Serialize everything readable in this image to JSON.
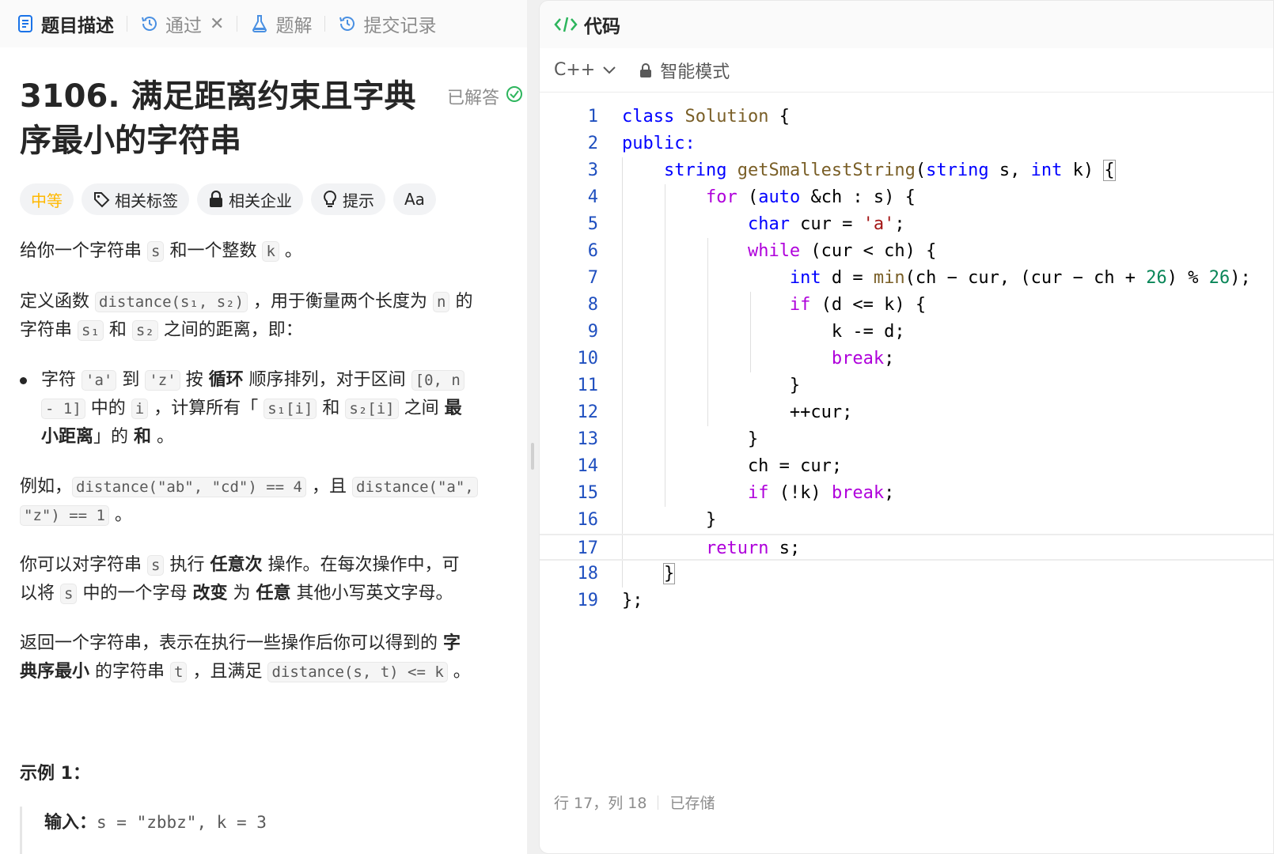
{
  "tabs": [
    {
      "label": "题目描述",
      "icon": "document-icon",
      "active": true
    },
    {
      "label": "通过",
      "icon": "history-icon",
      "closable": true
    },
    {
      "label": "题解",
      "icon": "flask-icon"
    },
    {
      "label": "提交记录",
      "icon": "history-icon"
    }
  ],
  "problem": {
    "title_line1": "3106. 满足距离约束且字典",
    "title_line2": "序最小的字符串",
    "status": "已解答"
  },
  "tags": {
    "difficulty": "中等",
    "related_tags": "相关标签",
    "related_companies": "相关企业",
    "hint": "提示",
    "font_toggle": "Aa"
  },
  "desc": {
    "p1": {
      "a": "给你一个字符串 ",
      "code_s": "s",
      "b": " 和一个整数 ",
      "code_k": "k",
      "c": " 。"
    },
    "p2": {
      "a": "定义函数 ",
      "code_dist": "distance(s₁, s₂)",
      "b": " ，用于衡量两个长度为 ",
      "code_n": "n",
      "c": " 的",
      "d": "字符串 ",
      "code_s1": "s₁",
      "e": " 和 ",
      "code_s2": "s₂",
      "f": " 之间的距离，即："
    },
    "bullet": {
      "a": "字符 ",
      "code_a": "'a'",
      "b": " 到 ",
      "code_z": "'z'",
      "c": " 按 ",
      "bold1": "循环",
      "d": " 顺序排列，对于区间 ",
      "code_range1": "[0, n",
      "code_range2": "- 1]",
      "e": " 中的 ",
      "code_i": "i",
      "f": " ，计算所有「 ",
      "code_s1i": "s₁[i]",
      "g": " 和 ",
      "code_s2i": "s₂[i]",
      "h": " 之间 ",
      "bold2a": "最",
      "bold2b": "小距离",
      "i": "」的 ",
      "bold3": "和",
      "j": " 。"
    },
    "p3": {
      "a": "例如，",
      "code1": "distance(\"ab\", \"cd\") == 4",
      "b": " ，且 ",
      "code2a": "distance(\"a\",",
      "code2b": "\"z\") == 1",
      "c": " 。"
    },
    "p4": {
      "a": "你可以对字符串 ",
      "code_s": "s",
      "b": " 执行 ",
      "bold1": "任意次",
      "c": " 操作。在每次操作中，可",
      "d": "以将 ",
      "code_s2": "s",
      "e": " 中的一个字母 ",
      "bold2": "改变",
      "f": " 为 ",
      "bold3": "任意",
      "g": " 其他小写英文字母。"
    },
    "p5": {
      "a": "返回一个字符串，表示在执行一些操作后你可以得到的 ",
      "bold1a": "字",
      "bold1b": "典序最小",
      "b": " 的字符串 ",
      "code_t": "t",
      "c": " ，且满足 ",
      "code_d": "distance(s, t) <= k",
      "d": " 。"
    }
  },
  "example": {
    "title": "示例 1：",
    "input_label": "输入：",
    "input_value": "s = \"zbbz\", k = 3"
  },
  "editor": {
    "header": "代码",
    "language": "C++",
    "mode": "智能模式",
    "lines": [
      "1",
      "2",
      "3",
      "4",
      "5",
      "6",
      "7",
      "8",
      "9",
      "10",
      "11",
      "12",
      "13",
      "14",
      "15",
      "16",
      "17",
      "18",
      "19"
    ],
    "status_position": "行 17，列 18",
    "status_saved": "已存储"
  }
}
